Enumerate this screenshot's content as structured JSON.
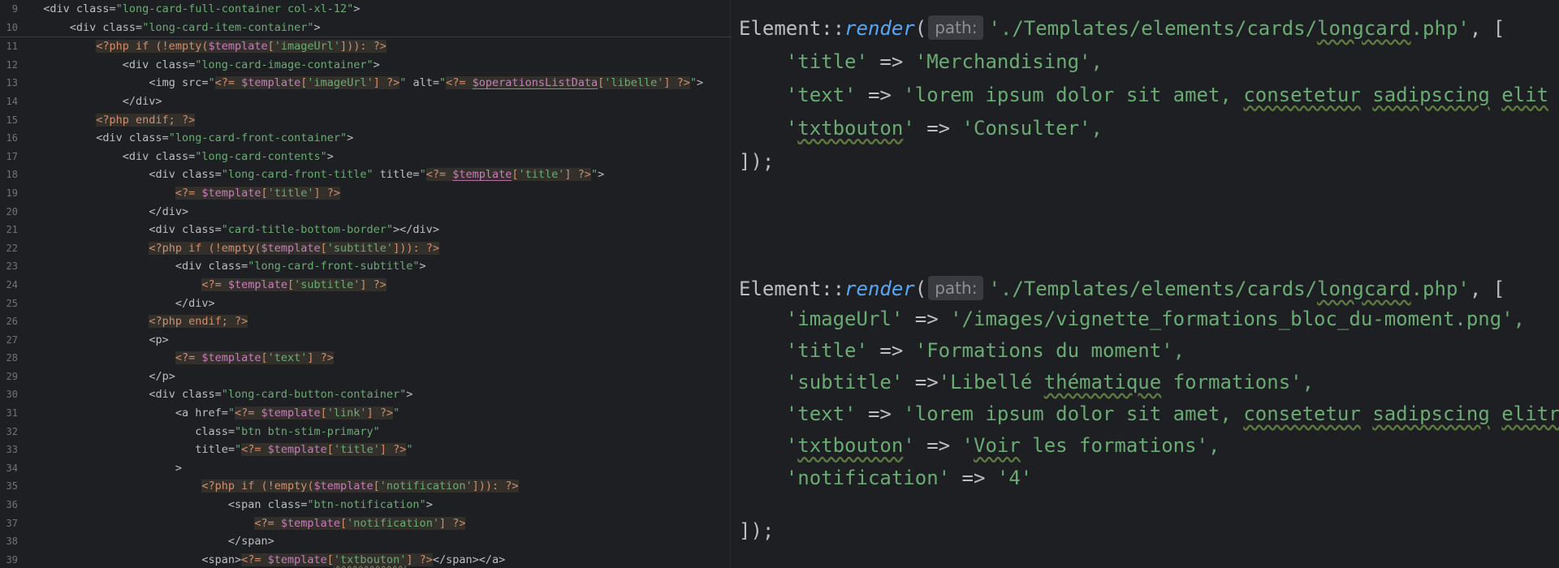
{
  "left_editor": {
    "lines": [
      {
        "num": "9",
        "indent": "  ",
        "parts": [
          [
            "t",
            "<div class="
          ],
          [
            "s",
            "\"long-card-full-container col-xl-12\""
          ],
          [
            "t",
            ">"
          ]
        ]
      },
      {
        "num": "10",
        "indent": "      ",
        "parts": [
          [
            "t",
            "<div class="
          ],
          [
            "s",
            "\"long-card-item-container\""
          ],
          [
            "t",
            ">"
          ]
        ]
      },
      {
        "num": "11",
        "indent": "          ",
        "parts": [
          [
            "pb",
            "<?php if (!empty("
          ],
          [
            "vb",
            "$template"
          ],
          [
            "pb",
            "["
          ],
          [
            "sb",
            "'imageUrl'"
          ],
          [
            "pb",
            "])): ?>"
          ]
        ]
      },
      {
        "num": "12",
        "indent": "              ",
        "parts": [
          [
            "t",
            "<div class="
          ],
          [
            "s",
            "\"long-card-image-container\""
          ],
          [
            "t",
            ">"
          ]
        ]
      },
      {
        "num": "13",
        "indent": "                  ",
        "parts": [
          [
            "t",
            "<img src="
          ],
          [
            "s",
            "\""
          ],
          [
            "pb",
            "<?= "
          ],
          [
            "vb",
            "$template"
          ],
          [
            "pb",
            "["
          ],
          [
            "sb",
            "'imageUrl'"
          ],
          [
            "pb",
            "] ?>"
          ],
          [
            "s",
            "\""
          ],
          [
            "t",
            " alt="
          ],
          [
            "s",
            "\""
          ],
          [
            "pb",
            "<?= "
          ],
          [
            "vu",
            "$operationsListData"
          ],
          [
            "pb",
            "["
          ],
          [
            "sb",
            "'libelle'"
          ],
          [
            "pb",
            "] ?>"
          ],
          [
            "s",
            "\""
          ],
          [
            "t",
            ">"
          ]
        ]
      },
      {
        "num": "14",
        "indent": "              ",
        "parts": [
          [
            "t",
            "</div>"
          ]
        ]
      },
      {
        "num": "15",
        "indent": "          ",
        "parts": [
          [
            "pb",
            "<?php endif; ?>"
          ]
        ]
      },
      {
        "num": "16",
        "indent": "          ",
        "parts": [
          [
            "t",
            "<div class="
          ],
          [
            "s",
            "\"long-card-front-container\""
          ],
          [
            "t",
            ">"
          ]
        ]
      },
      {
        "num": "17",
        "indent": "              ",
        "parts": [
          [
            "t",
            "<div class="
          ],
          [
            "s",
            "\"long-card-contents\""
          ],
          [
            "t",
            ">"
          ]
        ]
      },
      {
        "num": "18",
        "indent": "                  ",
        "parts": [
          [
            "t",
            "<div class="
          ],
          [
            "s",
            "\"long-card-front-title\""
          ],
          [
            "t",
            " title="
          ],
          [
            "s",
            "\""
          ],
          [
            "pb",
            "<?= "
          ],
          [
            "vu",
            "$template"
          ],
          [
            "pb",
            "["
          ],
          [
            "sb",
            "'title'"
          ],
          [
            "pb",
            "] ?>"
          ],
          [
            "s",
            "\""
          ],
          [
            "t",
            ">"
          ]
        ]
      },
      {
        "num": "19",
        "indent": "                      ",
        "parts": [
          [
            "pb",
            "<?= "
          ],
          [
            "vb",
            "$template"
          ],
          [
            "pb",
            "["
          ],
          [
            "sb",
            "'title'"
          ],
          [
            "pb",
            "] ?>"
          ]
        ]
      },
      {
        "num": "20",
        "indent": "                  ",
        "parts": [
          [
            "t",
            "</div>"
          ]
        ]
      },
      {
        "num": "21",
        "indent": "                  ",
        "parts": [
          [
            "t",
            "<div class="
          ],
          [
            "s",
            "\"card-title-bottom-border\""
          ],
          [
            "t",
            "></div>"
          ]
        ]
      },
      {
        "num": "22",
        "indent": "                  ",
        "parts": [
          [
            "pb",
            "<?php if (!empty("
          ],
          [
            "vb",
            "$template"
          ],
          [
            "pb",
            "["
          ],
          [
            "sb",
            "'subtitle'"
          ],
          [
            "pb",
            "])): ?>"
          ]
        ]
      },
      {
        "num": "23",
        "indent": "                      ",
        "parts": [
          [
            "t",
            "<div class="
          ],
          [
            "s",
            "\"long-card-front-subtitle\""
          ],
          [
            "t",
            ">"
          ]
        ]
      },
      {
        "num": "24",
        "indent": "                          ",
        "parts": [
          [
            "pb",
            "<?= "
          ],
          [
            "vb",
            "$template"
          ],
          [
            "pb",
            "["
          ],
          [
            "sb",
            "'subtitle'"
          ],
          [
            "pb",
            "] ?>"
          ]
        ]
      },
      {
        "num": "25",
        "indent": "                      ",
        "parts": [
          [
            "t",
            "</div>"
          ]
        ]
      },
      {
        "num": "26",
        "indent": "                  ",
        "parts": [
          [
            "pb",
            "<?php endif; ?>"
          ]
        ]
      },
      {
        "num": "27",
        "indent": "                  ",
        "parts": [
          [
            "t",
            "<p>"
          ]
        ]
      },
      {
        "num": "28",
        "indent": "                      ",
        "parts": [
          [
            "pb",
            "<?= "
          ],
          [
            "vb",
            "$template"
          ],
          [
            "pb",
            "["
          ],
          [
            "sb",
            "'text'"
          ],
          [
            "pb",
            "] ?>"
          ]
        ]
      },
      {
        "num": "29",
        "indent": "                  ",
        "parts": [
          [
            "t",
            "</p>"
          ]
        ]
      },
      {
        "num": "30",
        "indent": "                  ",
        "parts": [
          [
            "t",
            "<div class="
          ],
          [
            "s",
            "\"long-card-button-container\""
          ],
          [
            "t",
            ">"
          ]
        ]
      },
      {
        "num": "31",
        "indent": "                      ",
        "parts": [
          [
            "t",
            "<a href="
          ],
          [
            "s",
            "\""
          ],
          [
            "pb",
            "<?= "
          ],
          [
            "vb",
            "$template"
          ],
          [
            "pb",
            "["
          ],
          [
            "sb",
            "'link'"
          ],
          [
            "pb",
            "] ?>"
          ],
          [
            "s",
            "\""
          ]
        ]
      },
      {
        "num": "32",
        "indent": "                         ",
        "parts": [
          [
            "t",
            "class="
          ],
          [
            "s",
            "\"btn btn-stim-primary\""
          ]
        ]
      },
      {
        "num": "33",
        "indent": "                         ",
        "parts": [
          [
            "t",
            "title="
          ],
          [
            "s",
            "\""
          ],
          [
            "pb",
            "<?= "
          ],
          [
            "vb",
            "$template"
          ],
          [
            "pb",
            "["
          ],
          [
            "sb",
            "'title'"
          ],
          [
            "pb",
            "] ?>"
          ],
          [
            "s",
            "\""
          ]
        ]
      },
      {
        "num": "34",
        "indent": "                      ",
        "parts": [
          [
            "t",
            ">"
          ]
        ]
      },
      {
        "num": "35",
        "indent": "                          ",
        "parts": [
          [
            "pb",
            "<?php if (!empty("
          ],
          [
            "vb",
            "$template"
          ],
          [
            "pb",
            "["
          ],
          [
            "sb",
            "'notification'"
          ],
          [
            "pb",
            "])): ?>"
          ]
        ]
      },
      {
        "num": "36",
        "indent": "                              ",
        "parts": [
          [
            "t",
            "<span class="
          ],
          [
            "s",
            "\"btn-notification\""
          ],
          [
            "t",
            ">"
          ]
        ]
      },
      {
        "num": "37",
        "indent": "                                  ",
        "parts": [
          [
            "pb",
            "<?= "
          ],
          [
            "vb",
            "$template"
          ],
          [
            "pb",
            "["
          ],
          [
            "sb",
            "'notification'"
          ],
          [
            "pb",
            "] ?>"
          ]
        ]
      },
      {
        "num": "38",
        "indent": "                              ",
        "parts": [
          [
            "t",
            "</span>"
          ]
        ]
      },
      {
        "num": "39",
        "indent": "                          ",
        "parts": [
          [
            "t",
            "<span>"
          ],
          [
            "pb",
            "<?= "
          ],
          [
            "vb",
            "$template"
          ],
          [
            "pb",
            "["
          ],
          [
            "sbu",
            "'txtbouton'"
          ],
          [
            "pb",
            "] ?>"
          ],
          [
            "t",
            "</span></a>"
          ]
        ]
      }
    ]
  },
  "right_editor": {
    "block1": {
      "class": "Element",
      "sep": "::",
      "method": "render",
      "open_paren": "(",
      "hint": "path:",
      "path": "'./Templates/elements/cards/longcard.php'",
      "after_path": ", [",
      "entries": [
        {
          "key": "'title'",
          "op": " => ",
          "value": "'Merchandising',"
        },
        {
          "key": "'text'",
          "op": " => ",
          "value": "'lorem ipsum dolor sit amet, consetetur sadipscing elit"
        },
        {
          "key": "'txtbouton'",
          "op": " => ",
          "value": "'Consulter',"
        }
      ],
      "close": "]);"
    },
    "block2": {
      "class": "Element",
      "sep": "::",
      "method": "render",
      "open_paren": "(",
      "hint": "path:",
      "path": "'./Templates/elements/cards/longcard.php'",
      "after_path": ", [",
      "entries": [
        {
          "key": "'imageUrl'",
          "op": " => ",
          "value": "'/images/vignette_formations_bloc_du-moment.png',"
        },
        {
          "key": "'title'",
          "op": " => ",
          "value": "'Formations du moment',"
        },
        {
          "key": "'subtitle'",
          "op": " =>",
          "value": "'Libellé thématique formations',"
        },
        {
          "key": "'text'",
          "op": " => ",
          "value": "'lorem ipsum dolor sit amet, consetetur sadipscing elitr,"
        },
        {
          "key": "'txtbouton'",
          "op": " => ",
          "value": "'Voir les formations',"
        },
        {
          "key": "'notification'",
          "op": " => ",
          "value": "'4'"
        }
      ],
      "close": "]);"
    }
  },
  "colors": {
    "background": "#1e1f22",
    "string": "#6aab73",
    "php_tag": "#cf8e6d",
    "variable": "#c77dbb",
    "method": "#56a8f5",
    "text": "#bcbec4"
  }
}
